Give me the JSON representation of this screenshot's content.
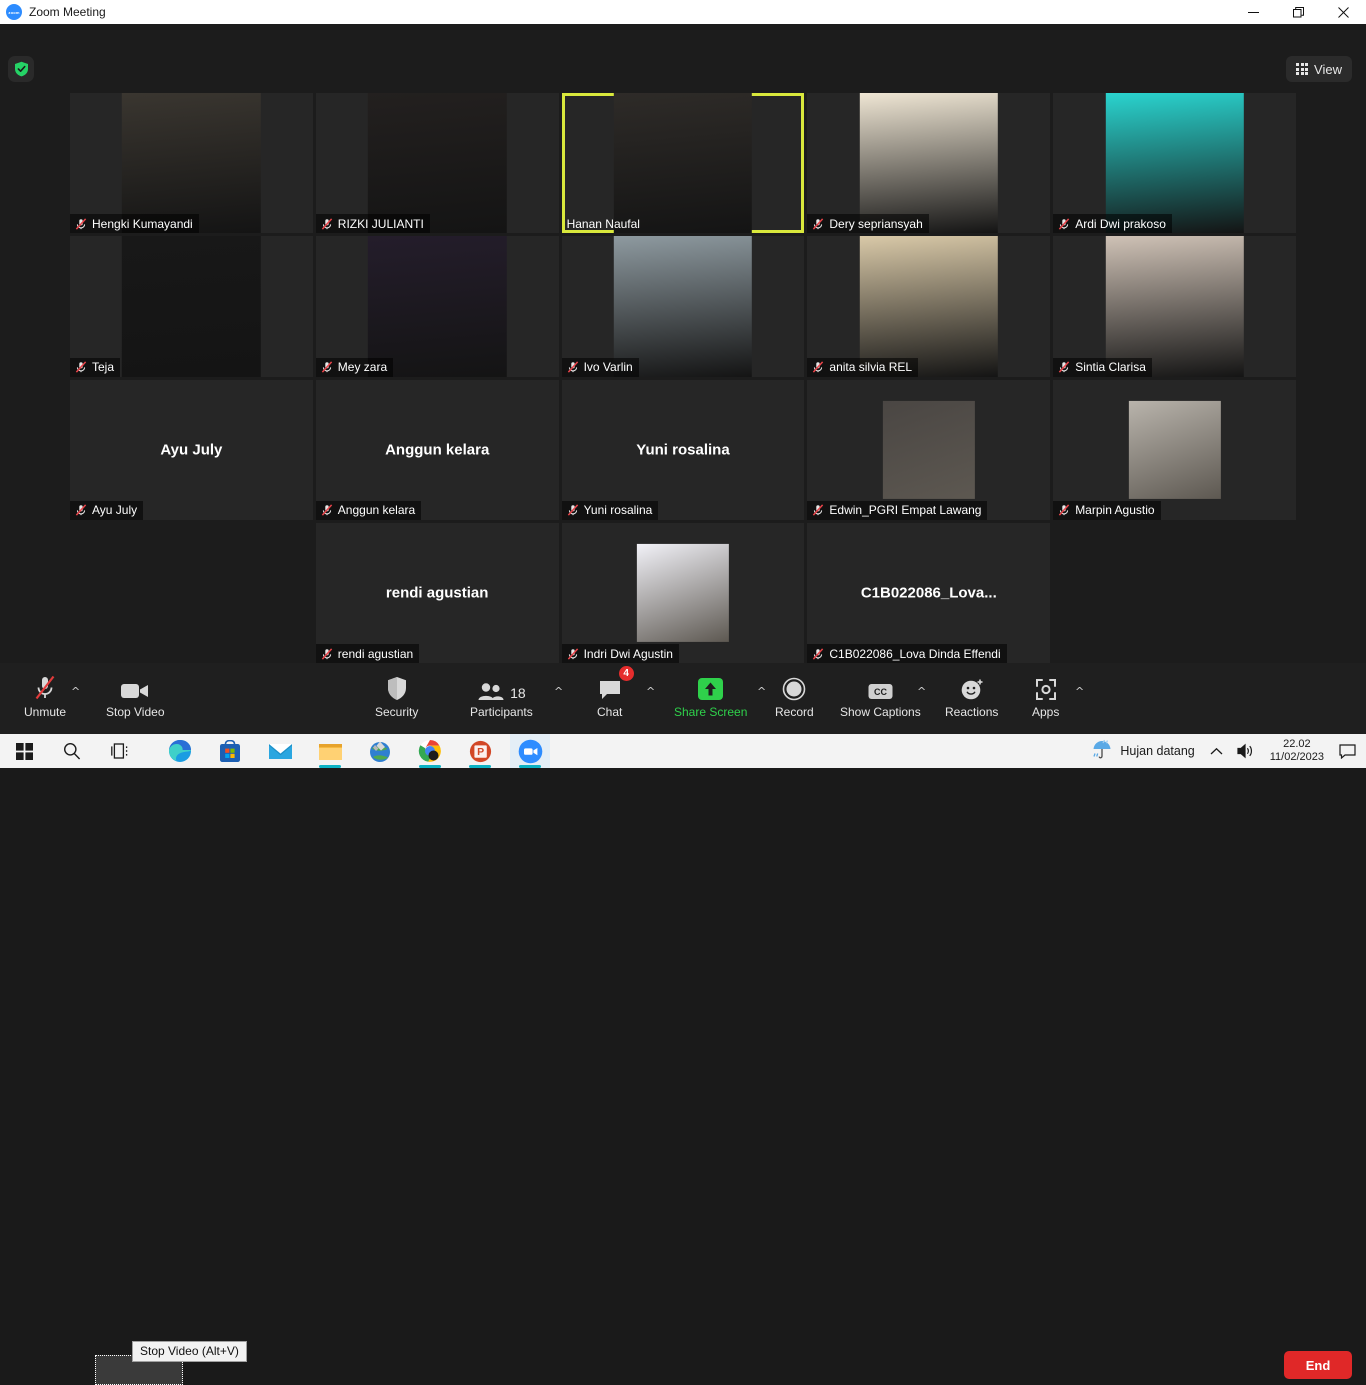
{
  "window": {
    "title": "Zoom Meeting",
    "logo_icon": "zoom-logo",
    "minimize_icon": "minimize-icon",
    "restore_icon": "restore-icon",
    "close_icon": "close-icon"
  },
  "header": {
    "encryption_icon": "green-shield-check-icon",
    "view_label": "View",
    "view_icon": "grid-icon"
  },
  "gallery": {
    "participants": [
      {
        "name": "Hengki Kumayandi",
        "muted": true,
        "state": "video",
        "active": false,
        "row": 1,
        "col": 1
      },
      {
        "name": "RIZKI JULIANTI",
        "muted": true,
        "state": "video",
        "active": false,
        "row": 1,
        "col": 2
      },
      {
        "name": "Hanan Naufal",
        "muted": false,
        "state": "video",
        "active": true,
        "row": 1,
        "col": 3
      },
      {
        "name": "Dery sepriansyah",
        "muted": true,
        "state": "video",
        "active": false,
        "row": 1,
        "col": 4
      },
      {
        "name": "Ardi Dwi prakoso",
        "muted": true,
        "state": "video",
        "active": false,
        "row": 1,
        "col": 5
      },
      {
        "name": "Teja",
        "muted": true,
        "state": "video",
        "active": false,
        "row": 2,
        "col": 1
      },
      {
        "name": "Mey zara",
        "muted": true,
        "state": "video",
        "active": false,
        "row": 2,
        "col": 2
      },
      {
        "name": "Ivo Varlin",
        "muted": true,
        "state": "video",
        "active": false,
        "row": 2,
        "col": 3
      },
      {
        "name": "anita silvia REL",
        "muted": true,
        "state": "video",
        "active": false,
        "row": 2,
        "col": 4
      },
      {
        "name": "Sintia Clarisa",
        "muted": true,
        "state": "video",
        "active": false,
        "row": 2,
        "col": 5
      },
      {
        "name": "Ayu July",
        "muted": true,
        "state": "name",
        "active": false,
        "row": 3,
        "col": 1,
        "center_label": "Ayu July"
      },
      {
        "name": "Anggun kelara",
        "muted": true,
        "state": "name",
        "active": false,
        "row": 3,
        "col": 2,
        "center_label": "Anggun kelara"
      },
      {
        "name": "Yuni rosalina",
        "muted": true,
        "state": "name",
        "active": false,
        "row": 3,
        "col": 3,
        "center_label": "Yuni rosalina"
      },
      {
        "name": "Edwin_PGRI Empat Lawang",
        "muted": true,
        "state": "avatar",
        "active": false,
        "row": 3,
        "col": 4
      },
      {
        "name": "Marpin Agustio",
        "muted": true,
        "state": "avatar",
        "active": false,
        "row": 3,
        "col": 5
      },
      {
        "name": "rendi agustian",
        "muted": true,
        "state": "name",
        "active": false,
        "row": 4,
        "col": 2,
        "center_label": "rendi agustian"
      },
      {
        "name": "Indri Dwi Agustin",
        "muted": true,
        "state": "avatar",
        "active": false,
        "row": 4,
        "col": 3
      },
      {
        "name": "C1B022086_Lova Dinda Effendi",
        "muted": true,
        "state": "name",
        "active": false,
        "row": 4,
        "col": 4,
        "center_label": "C1B022086_Lova..."
      }
    ],
    "mute_icon": "microphone-muted-icon"
  },
  "toolbar": {
    "audio": {
      "label": "Unmute",
      "icon": "microphone-muted-icon",
      "has_caret": true
    },
    "video": {
      "label": "Stop Video",
      "icon": "camera-icon",
      "tooltip": "Stop Video (Alt+V)",
      "focused": true
    },
    "security": {
      "label": "Security",
      "icon": "shield-icon"
    },
    "participants": {
      "label": "Participants",
      "icon": "people-icon",
      "count": "18",
      "has_caret": true
    },
    "chat": {
      "label": "Chat",
      "icon": "chat-bubble-icon",
      "badge": "4",
      "has_caret": true
    },
    "share": {
      "label": "Share Screen",
      "icon": "share-up-arrow-icon",
      "has_caret": true,
      "color": "#2fd14b"
    },
    "record": {
      "label": "Record",
      "icon": "record-circle-icon"
    },
    "captions": {
      "label": "Show Captions",
      "icon": "cc-icon",
      "has_caret": true
    },
    "reactions": {
      "label": "Reactions",
      "icon": "smiley-plus-icon"
    },
    "apps": {
      "label": "Apps",
      "icon": "apps-icon",
      "has_caret": true
    },
    "end": {
      "label": "End",
      "color": "#e02828"
    }
  },
  "taskbar": {
    "items": [
      {
        "icon": "windows-start-icon",
        "active": false
      },
      {
        "icon": "search-icon",
        "active": false
      },
      {
        "icon": "task-view-icon",
        "active": false
      },
      {
        "icon": "edge-browser-icon",
        "active": false
      },
      {
        "icon": "microsoft-store-icon",
        "active": false
      },
      {
        "icon": "mail-icon",
        "active": false
      },
      {
        "icon": "file-explorer-icon",
        "active": false,
        "running": true
      },
      {
        "icon": "paint-globe-icon",
        "active": false
      },
      {
        "icon": "chrome-browser-icon",
        "active": false,
        "running": true
      },
      {
        "icon": "powerpoint-icon",
        "active": false,
        "running": true
      },
      {
        "icon": "zoom-app-icon",
        "active": true,
        "running": true
      }
    ],
    "tray": {
      "weather_icon": "rain-umbrella-icon",
      "weather_label": "Hujan datang",
      "overflow_icon": "chevron-up-icon",
      "volume_icon": "speaker-icon",
      "time": "22.02",
      "date": "11/02/2023",
      "notification_icon": "notification-icon"
    }
  }
}
